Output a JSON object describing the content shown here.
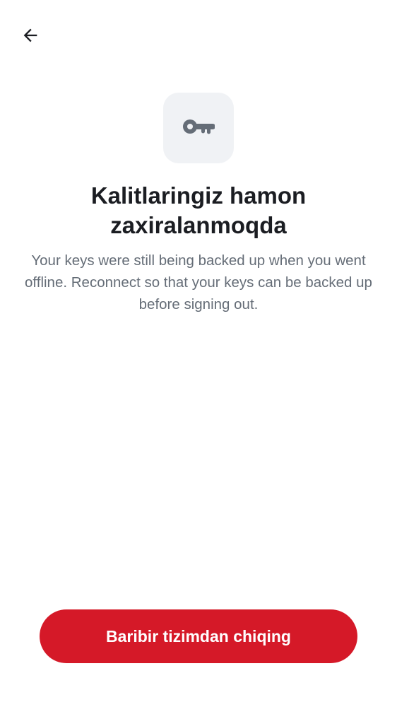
{
  "header": {
    "back_icon": "arrow-left-icon"
  },
  "hero": {
    "icon": "key-icon",
    "title": "Kalitlaringiz hamon zaxiralanmoqda",
    "description": "Your keys were still being backed up when you went offline. Reconnect so that your keys can be backed up before signing out."
  },
  "actions": {
    "signout_label": "Baribir tizimdan chiqing"
  },
  "colors": {
    "accent": "#d51928",
    "icon_tile": "#f0f2f5",
    "title_text": "#1b1d22",
    "body_text": "#656d77"
  }
}
